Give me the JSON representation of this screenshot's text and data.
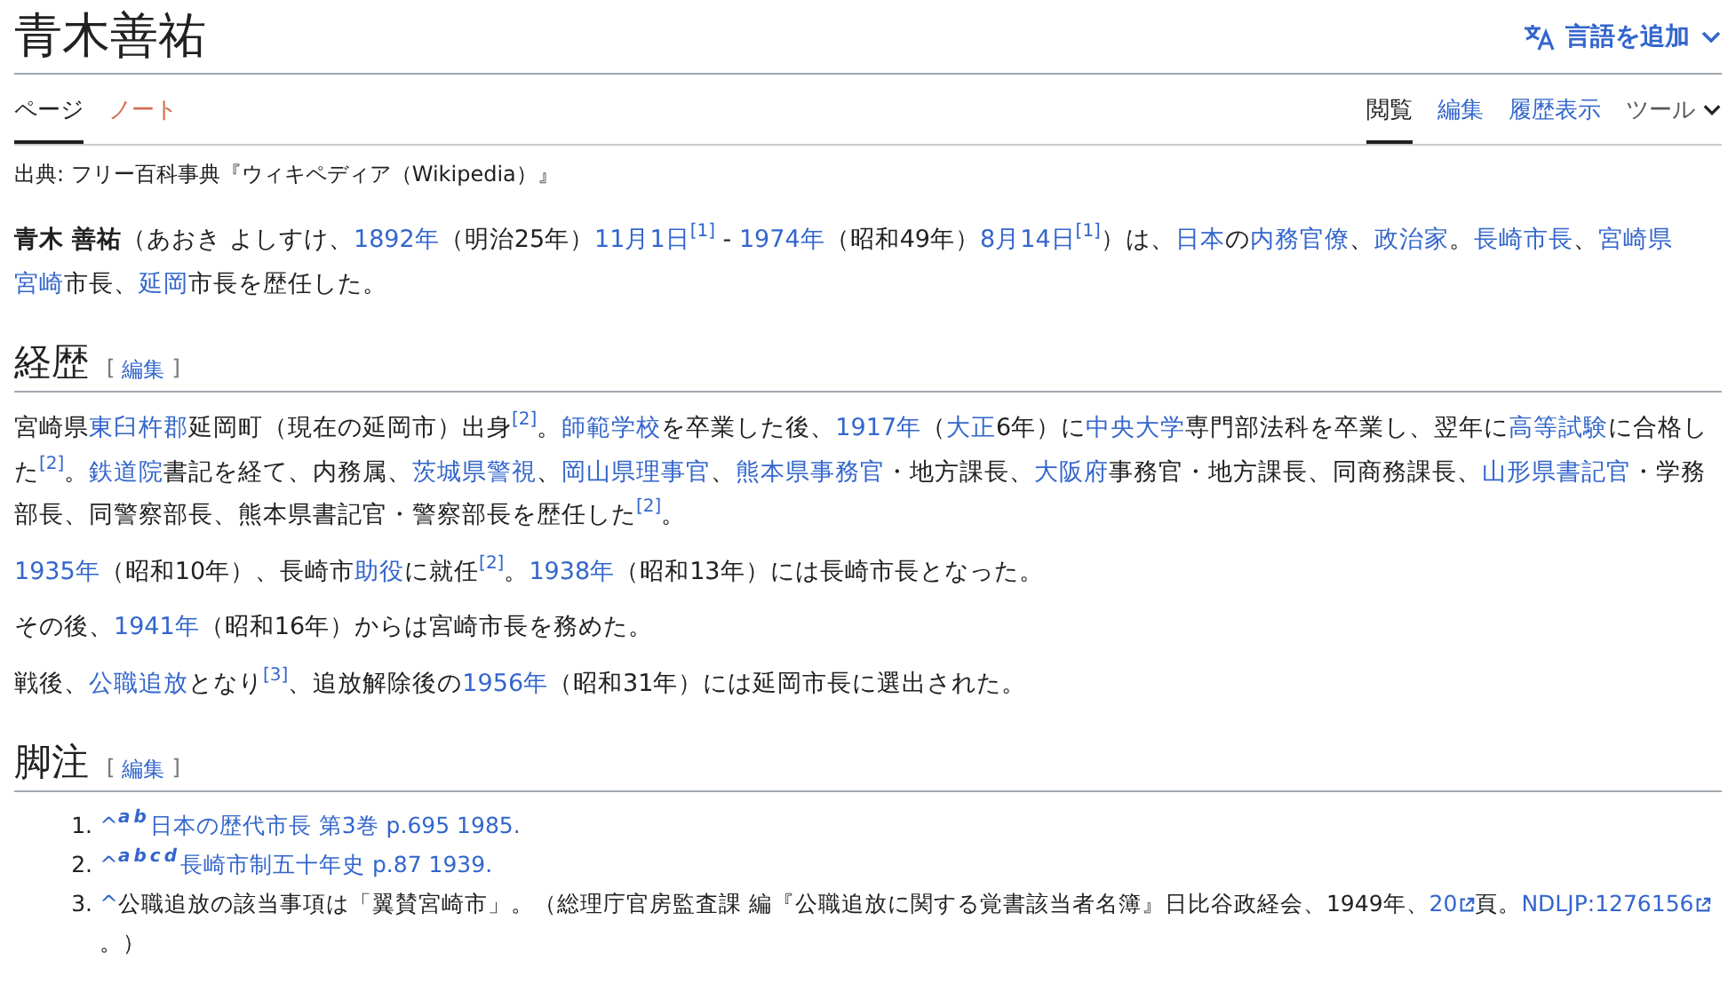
{
  "page": {
    "title": "青木善祐",
    "language_button": "言語を追加"
  },
  "namespace_tabs": [
    {
      "label": "ページ",
      "selected": true,
      "missing": false
    },
    {
      "label": "ノート",
      "selected": false,
      "missing": true
    }
  ],
  "view_tabs": [
    {
      "label": "閲覧",
      "selected": true,
      "kind": "tab"
    },
    {
      "label": "編集",
      "selected": false,
      "kind": "tab"
    },
    {
      "label": "履歴表示",
      "selected": false,
      "kind": "tab"
    },
    {
      "label": "ツール",
      "selected": false,
      "kind": "menu"
    }
  ],
  "site_sub": "出典: フリー百科事典『ウィキペディア（Wikipedia）』",
  "lead": [
    [
      {
        "kind": "bold",
        "text": "青木 善祐"
      },
      {
        "kind": "plain",
        "text": "（あおき よしすけ、"
      },
      {
        "kind": "link",
        "text": "1892年"
      },
      {
        "kind": "plain",
        "text": "（明治25年）"
      },
      {
        "kind": "link",
        "text": "11月1日"
      },
      {
        "kind": "ref",
        "text": "[1]"
      },
      {
        "kind": "plain",
        "text": " - "
      },
      {
        "kind": "link",
        "text": "1974年"
      },
      {
        "kind": "plain",
        "text": "（昭和49年）"
      },
      {
        "kind": "link",
        "text": "8月14日"
      },
      {
        "kind": "ref",
        "text": "[1]"
      },
      {
        "kind": "plain",
        "text": "）は、"
      },
      {
        "kind": "link",
        "text": "日本"
      },
      {
        "kind": "plain",
        "text": "の"
      },
      {
        "kind": "link",
        "text": "内務官僚"
      },
      {
        "kind": "plain",
        "text": "、"
      },
      {
        "kind": "link",
        "text": "政治家"
      },
      {
        "kind": "plain",
        "text": "。"
      },
      {
        "kind": "link",
        "text": "長崎市長"
      },
      {
        "kind": "plain",
        "text": "、"
      },
      {
        "kind": "link",
        "text": "宮崎県"
      },
      {
        "kind": "link",
        "text": "宮崎"
      },
      {
        "kind": "plain",
        "text": "市長、"
      },
      {
        "kind": "link",
        "text": "延岡"
      },
      {
        "kind": "plain",
        "text": "市長を歴任した。"
      }
    ]
  ],
  "sections": [
    {
      "heading": "経歴",
      "edit_open": "[",
      "edit_link": "編集",
      "edit_close": "]",
      "paragraphs": [
        [
          {
            "kind": "plain",
            "text": "宮崎県"
          },
          {
            "kind": "link",
            "text": "東臼杵郡"
          },
          {
            "kind": "plain",
            "text": "延岡町（現在の延岡市）出身"
          },
          {
            "kind": "ref",
            "text": "[2]"
          },
          {
            "kind": "plain",
            "text": "。"
          },
          {
            "kind": "link",
            "text": "師範学校"
          },
          {
            "kind": "plain",
            "text": "を卒業した後、"
          },
          {
            "kind": "link",
            "text": "1917年"
          },
          {
            "kind": "plain",
            "text": "（"
          },
          {
            "kind": "link",
            "text": "大正"
          },
          {
            "kind": "plain",
            "text": "6年）に"
          },
          {
            "kind": "link",
            "text": "中央大学"
          },
          {
            "kind": "plain",
            "text": "専門部法科を卒業し、翌年に"
          },
          {
            "kind": "link",
            "text": "高等試験"
          },
          {
            "kind": "plain",
            "text": "に合格した"
          },
          {
            "kind": "ref",
            "text": "[2]"
          },
          {
            "kind": "plain",
            "text": "。"
          },
          {
            "kind": "link",
            "text": "鉄道院"
          },
          {
            "kind": "plain",
            "text": "書記を経て、内務属、"
          },
          {
            "kind": "link",
            "text": "茨城県警視"
          },
          {
            "kind": "plain",
            "text": "、"
          },
          {
            "kind": "link",
            "text": "岡山県理事官"
          },
          {
            "kind": "plain",
            "text": "、"
          },
          {
            "kind": "link",
            "text": "熊本県事務官"
          },
          {
            "kind": "plain",
            "text": "・地方課長、"
          },
          {
            "kind": "link",
            "text": "大阪府"
          },
          {
            "kind": "plain",
            "text": "事務官・地方課長、同商務課長、"
          },
          {
            "kind": "link",
            "text": "山形県書記官"
          },
          {
            "kind": "plain",
            "text": "・学務部長、同警察部長、熊本県書記官・警察部長を歴任した"
          },
          {
            "kind": "ref",
            "text": "[2]"
          },
          {
            "kind": "plain",
            "text": "。"
          }
        ],
        [
          {
            "kind": "link",
            "text": "1935年"
          },
          {
            "kind": "plain",
            "text": "（昭和10年）、長崎市"
          },
          {
            "kind": "link",
            "text": "助役"
          },
          {
            "kind": "plain",
            "text": "に就任"
          },
          {
            "kind": "ref",
            "text": "[2]"
          },
          {
            "kind": "plain",
            "text": "。"
          },
          {
            "kind": "link",
            "text": "1938年"
          },
          {
            "kind": "plain",
            "text": "（昭和13年）には長崎市長となった。"
          }
        ],
        [
          {
            "kind": "plain",
            "text": "その後、"
          },
          {
            "kind": "link",
            "text": "1941年"
          },
          {
            "kind": "plain",
            "text": "（昭和16年）からは宮崎市長を務めた。"
          }
        ],
        [
          {
            "kind": "plain",
            "text": "戦後、"
          },
          {
            "kind": "link",
            "text": "公職追放"
          },
          {
            "kind": "plain",
            "text": "となり"
          },
          {
            "kind": "ref",
            "text": "[3]"
          },
          {
            "kind": "plain",
            "text": "、追放解除後の"
          },
          {
            "kind": "link",
            "text": "1956年"
          },
          {
            "kind": "plain",
            "text": "（昭和31年）には延岡市長に選出された。"
          }
        ]
      ]
    }
  ],
  "references": {
    "heading": "脚注",
    "edit_open": "[",
    "edit_link": "編集",
    "edit_close": "]",
    "items": [
      {
        "number": "1.",
        "runs": [
          {
            "kind": "caret",
            "text": "^"
          },
          {
            "kind": "backref",
            "text": "a"
          },
          {
            "kind": "backref",
            "text": "b"
          },
          {
            "kind": "link",
            "text": "日本の歴代市長 第3巻 p.695 1985."
          }
        ]
      },
      {
        "number": "2.",
        "runs": [
          {
            "kind": "caret",
            "text": "^"
          },
          {
            "kind": "backref",
            "text": "a"
          },
          {
            "kind": "backref",
            "text": "b"
          },
          {
            "kind": "backref",
            "text": "c"
          },
          {
            "kind": "backref",
            "text": "d"
          },
          {
            "kind": "link",
            "text": "長崎市制五十年史 p.87 1939."
          }
        ]
      },
      {
        "number": "3.",
        "runs": [
          {
            "kind": "caret",
            "text": "^"
          },
          {
            "kind": "plain",
            "text": "公職追放の該当事項は「翼賛宮崎市」。（総理庁官房監査課 編『公職追放に関する覚書該当者名簿』日比谷政経会、1949年、"
          },
          {
            "kind": "external",
            "text": "20"
          },
          {
            "kind": "plain",
            "text": "頁。"
          },
          {
            "kind": "external",
            "text": "NDLJP:1276156"
          },
          {
            "kind": "plain",
            "text": "。）"
          }
        ]
      }
    ]
  }
}
